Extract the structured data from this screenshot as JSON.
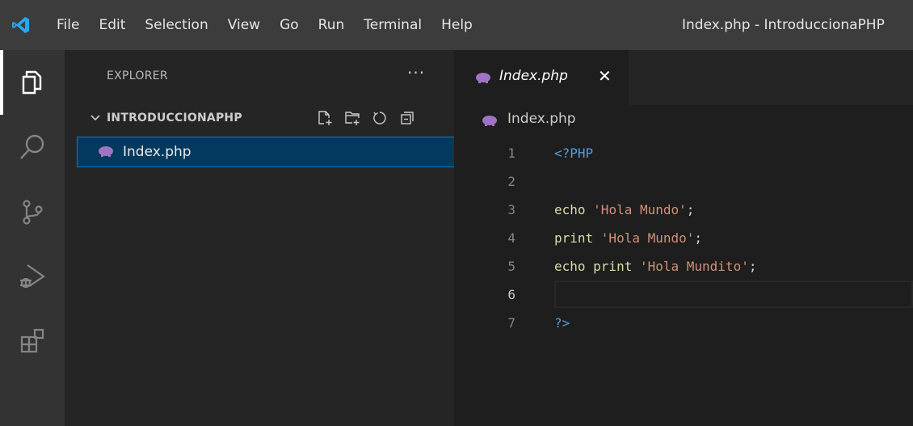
{
  "menu": [
    "File",
    "Edit",
    "Selection",
    "View",
    "Go",
    "Run",
    "Terminal",
    "Help"
  ],
  "window_title": "Index.php - IntroduccionaPHP",
  "activity_bar": {
    "items": [
      "files-icon",
      "search-icon",
      "source-control-icon",
      "run-debug-icon",
      "extensions-icon"
    ]
  },
  "explorer": {
    "title": "EXPLORER",
    "more": "···",
    "section_title": "INTRODUCCIONAPHP",
    "files": [
      {
        "label": "Index.php"
      }
    ]
  },
  "editor": {
    "tab_label": "Index.php",
    "tab_close": "✕",
    "breadcrumb": "Index.php",
    "lines": [
      {
        "num": "1",
        "tokens": [
          {
            "t": "<?PHP",
            "c": "kw-tag"
          }
        ]
      },
      {
        "num": "2",
        "tokens": []
      },
      {
        "num": "3",
        "tokens": [
          {
            "t": "echo ",
            "c": "kw-fn"
          },
          {
            "t": "'Hola Mundo'",
            "c": "str"
          },
          {
            "t": ";",
            "c": "punct"
          }
        ]
      },
      {
        "num": "4",
        "tokens": [
          {
            "t": "print ",
            "c": "kw-fn"
          },
          {
            "t": "'Hola Mundo'",
            "c": "str"
          },
          {
            "t": ";",
            "c": "punct"
          }
        ]
      },
      {
        "num": "5",
        "tokens": [
          {
            "t": "echo print ",
            "c": "kw-fn"
          },
          {
            "t": "'Hola Mundito'",
            "c": "str"
          },
          {
            "t": ";",
            "c": "punct"
          }
        ]
      },
      {
        "num": "6",
        "current": true,
        "tokens": []
      },
      {
        "num": "7",
        "tokens": [
          {
            "t": "?>",
            "c": "kw-tag"
          }
        ]
      }
    ]
  },
  "colors": {
    "accent": "#007fd4",
    "selection": "#04395e",
    "php_icon": "#a074c4"
  }
}
